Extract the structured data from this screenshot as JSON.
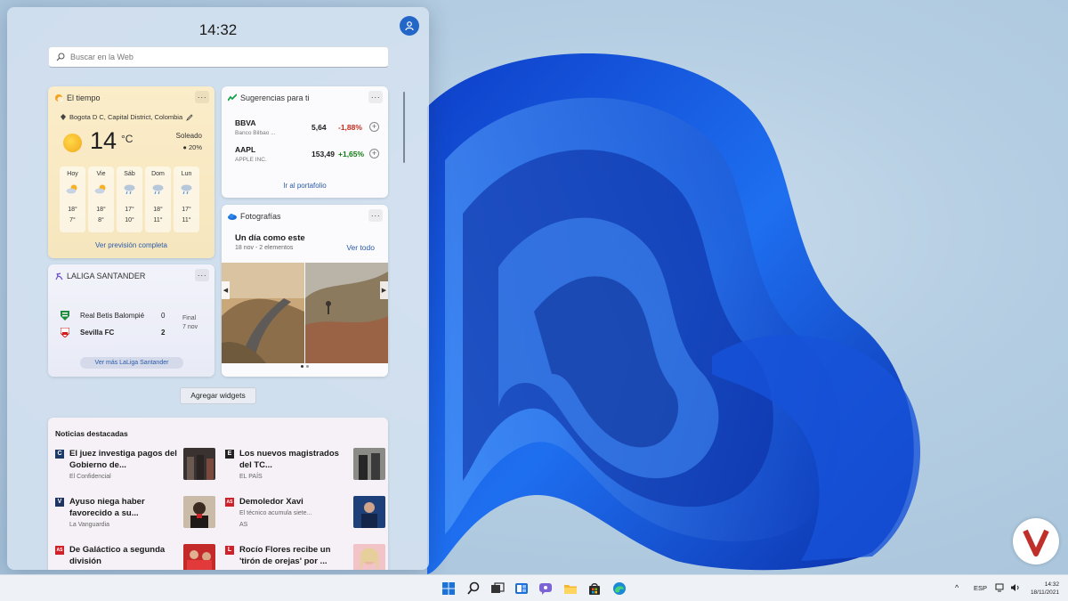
{
  "panel": {
    "clock": "14:32",
    "search_placeholder": "Buscar en la Web"
  },
  "weather": {
    "title": "El tiempo",
    "location": "Bogota D C, Capital District, Colombia",
    "temperature": "14",
    "unit": "°C",
    "condition": "Soleado",
    "rain_chance": "20%",
    "forecast": [
      {
        "day": "Hoy",
        "high": "18°",
        "low": "7°",
        "icon": "partly-cloudy-icon"
      },
      {
        "day": "Vie",
        "high": "18°",
        "low": "8°",
        "icon": "partly-cloudy-icon"
      },
      {
        "day": "Sáb",
        "high": "17°",
        "low": "10°",
        "icon": "rain-icon"
      },
      {
        "day": "Dom",
        "high": "18°",
        "low": "11°",
        "icon": "rain-icon"
      },
      {
        "day": "Lun",
        "high": "17°",
        "low": "11°",
        "icon": "rain-icon"
      }
    ],
    "link": "Ver previsión completa"
  },
  "stocks": {
    "title": "Sugerencias para ti",
    "items": [
      {
        "symbol": "BBVA",
        "name": "Banco Bilbao ...",
        "price": "5,64",
        "change": "-1,88%",
        "color": "#c42b1c"
      },
      {
        "symbol": "AAPL",
        "name": "APPLE INC.",
        "price": "153,49",
        "change": "+1,65%",
        "color": "#0f7b0f"
      }
    ],
    "link": "Ir al portafolio"
  },
  "photos": {
    "title": "Fotografías",
    "heading": "Un día como este",
    "subheading": "18 nov - 2 elementos",
    "see_all": "Ver todo"
  },
  "laliga": {
    "title": "LALIGA SANTANDER",
    "teams": [
      {
        "name": "Real Betis Balompié",
        "score": "0"
      },
      {
        "name": "Sevilla FC",
        "score": "2"
      }
    ],
    "status": "Final",
    "date": "7 nov",
    "button": "Ver más LaLiga Santander"
  },
  "add_widgets": "Agregar widgets",
  "news": {
    "title": "Noticias destacadas",
    "items": [
      {
        "headline": "El juez investiga pagos del Gobierno de...",
        "source": "El Confidencial",
        "badge": "C",
        "badge_color": "#1d3b66"
      },
      {
        "headline": "Los nuevos magistrados del TC...",
        "source": "EL PAÍS",
        "badge": "E",
        "badge_color": "#222222"
      },
      {
        "headline": "Ayuso niega haber favorecido a su...",
        "source": "La Vanguardia",
        "badge": "V",
        "badge_color": "#1f3460"
      },
      {
        "headline": "Demoledor Xavi",
        "source": "AS",
        "snippet": "El técnico acumula siete...",
        "badge": "AS",
        "badge_color": "#d0202a"
      },
      {
        "headline": "De Galáctico a segunda división",
        "source": "",
        "badge": "AS",
        "badge_color": "#d0202a"
      },
      {
        "headline": "Rocío Flores recibe un 'tirón de orejas' por ...",
        "source": "",
        "badge": "L",
        "badge_color": "#d0202a"
      }
    ]
  },
  "taskbar": {
    "language": "ESP",
    "time": "14:32",
    "date": "18/11/2021"
  }
}
